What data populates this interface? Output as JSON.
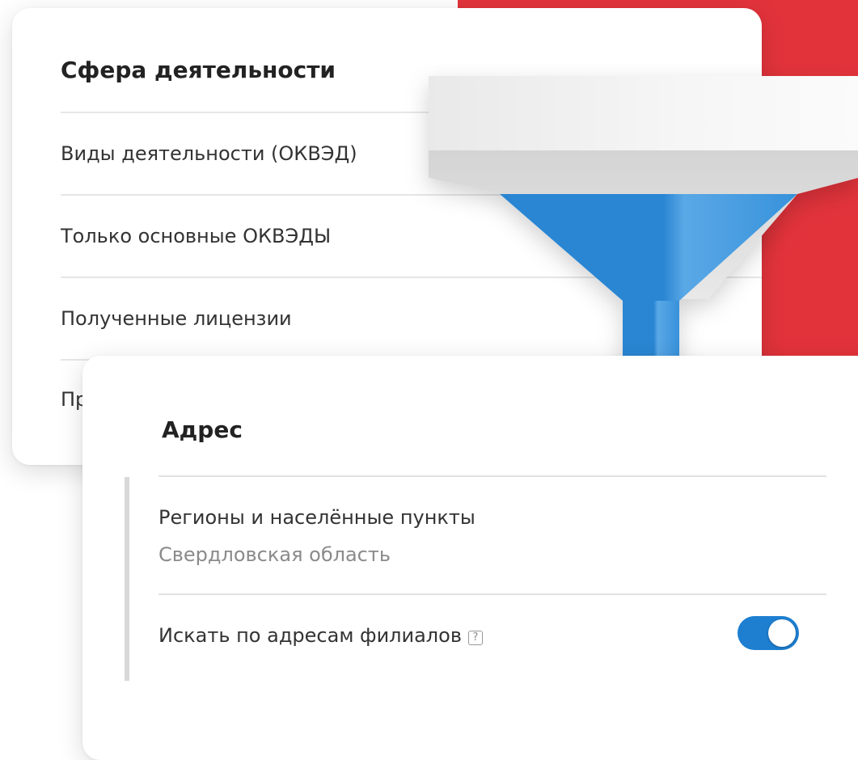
{
  "activity_card": {
    "title": "Сфера деятельности",
    "items": [
      "Виды деятельности (ОКВЭД)",
      "Только основные ОКВЭДЫ",
      "Полученные лицензии",
      "Пр"
    ]
  },
  "address_card": {
    "title": "Адрес",
    "regions_label": "Регионы и населённые пункты",
    "regions_value": "Свердловская область",
    "branches_label": "Искать по адресам филиалов",
    "help_glyph": "?",
    "branches_toggle_on": true
  },
  "icons": {
    "funnel": "filter-funnel-icon",
    "help": "question-icon"
  },
  "colors": {
    "accent_red": "#e2333b",
    "toggle_blue": "#1e7fd1",
    "funnel_blue": "#2a86d3"
  }
}
